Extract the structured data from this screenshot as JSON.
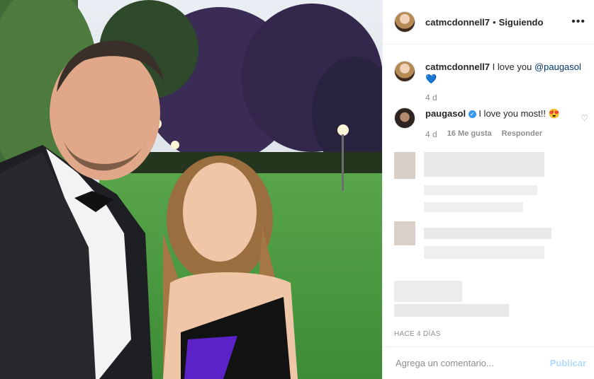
{
  "header": {
    "username": "catmcdonnell7",
    "separator": "•",
    "follow_status": "Siguiendo",
    "more_label": "•••"
  },
  "comments": [
    {
      "username": "catmcdonnell7",
      "text": "I love you",
      "mention": "@paugasol",
      "emoji": "💙",
      "time": "4 d"
    },
    {
      "username": "paugasol",
      "text": "I love you most!!",
      "emoji": "😍",
      "time": "4 d",
      "likes": "16 Me gusta",
      "reply": "Responder"
    }
  ],
  "timestamp": "HACE 4 DÍAS",
  "add_comment": {
    "placeholder": "Agrega un comentario...",
    "post_label": "Publicar"
  },
  "colors": {
    "link": "#00376b",
    "accent": "#3897f0",
    "muted": "#8e8e8e",
    "post_disabled": "#b3dbff"
  },
  "icons": {
    "verified": "verified-badge-icon",
    "like": "heart-outline-icon",
    "more": "more-options-icon"
  }
}
